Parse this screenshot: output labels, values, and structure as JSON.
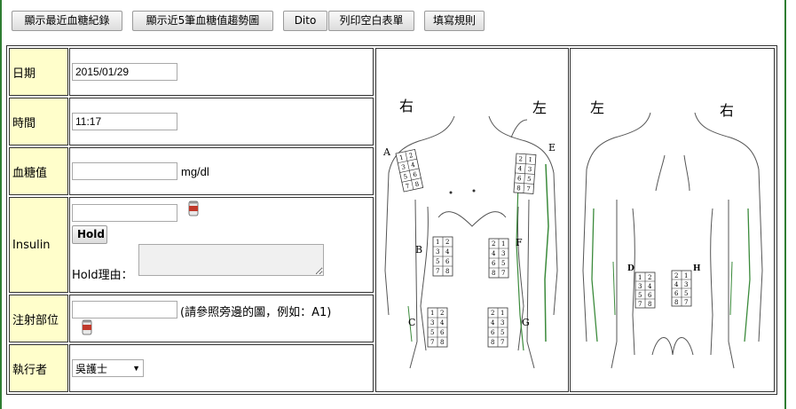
{
  "toolbar": {
    "recent_records": "顯示最近血糖紀錄",
    "trend_chart": "顯示近5筆血糖值趨勢圖",
    "dito": "Dito",
    "print_blank": "列印空白表單",
    "fill_rules": "填寫規則"
  },
  "form": {
    "date_label": "日期",
    "date_value": "2015/01/29",
    "time_label": "時間",
    "time_value": "11:17",
    "glucose_label": "血糖值",
    "glucose_value": "",
    "glucose_unit": "mg/dl",
    "insulin_label": "Insulin",
    "insulin_value": "",
    "hold_button": "Hold",
    "hold_reason_label": "Hold理由：",
    "hold_reason_value": "",
    "site_label": "注射部位",
    "site_value": "",
    "site_hint": "(請參照旁邊的圖，例如：A1)",
    "executor_label": "執行者",
    "executor_selected": "吳護士"
  },
  "diagram_front": {
    "right": "右",
    "left": "左",
    "regions": [
      "A",
      "B",
      "C",
      "E",
      "F",
      "G"
    ]
  },
  "diagram_back": {
    "left": "左",
    "right": "右",
    "regions": [
      "D",
      "H"
    ]
  },
  "grid_numbers": [
    "1",
    "2",
    "3",
    "4",
    "5",
    "6",
    "7",
    "8"
  ],
  "colors": {
    "frame": "#2e7d32",
    "label_bg": "#fffecb",
    "body_outline_green": "#3b8a3b"
  }
}
